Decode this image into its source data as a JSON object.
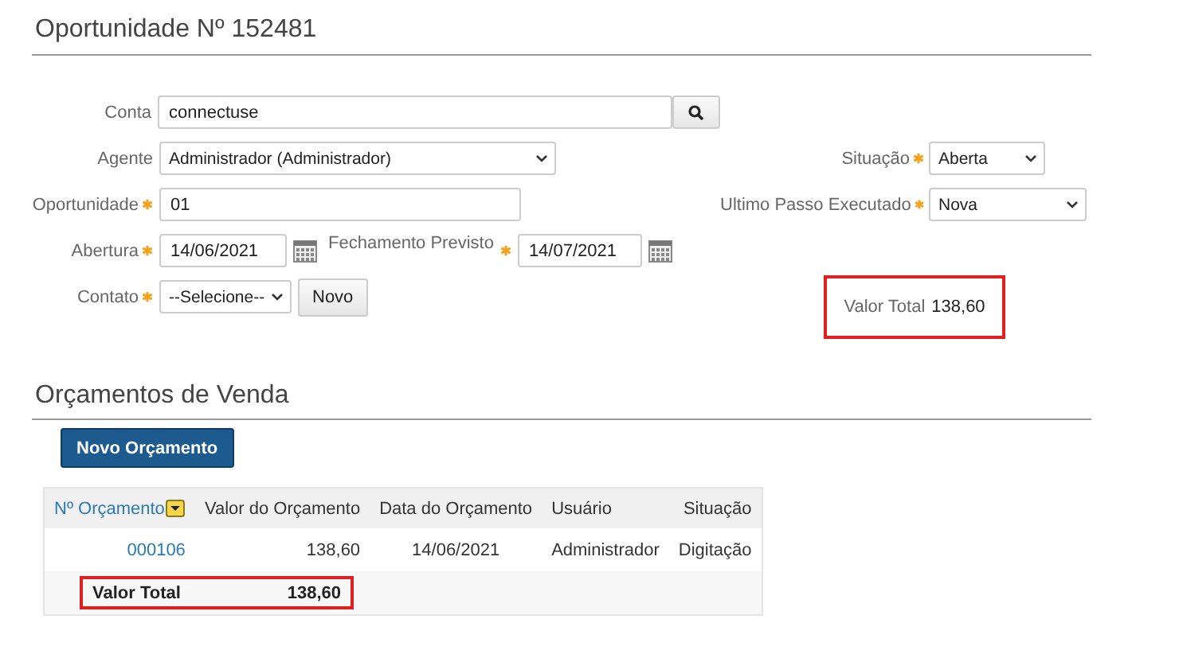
{
  "page_title": "Oportunidade Nº 152481",
  "left_fields": [
    {
      "kind": "search",
      "label": "Conta",
      "required": false,
      "value": "connectuse"
    },
    {
      "kind": "select",
      "label": "Agente",
      "required": false,
      "value": "Administrador (Administrador)"
    },
    {
      "kind": "text",
      "label": "Oportunidade",
      "required": true,
      "value": "01"
    },
    {
      "kind": "dates",
      "label": "Abertura",
      "required": true,
      "value": "14/06/2021",
      "second_label": "Fechamento Previsto",
      "second_required": true,
      "second_value": "14/07/2021"
    },
    {
      "kind": "select_button",
      "label": "Contato",
      "required": true,
      "value": "--Selecione--",
      "button": "Novo"
    }
  ],
  "right_fields": [
    {
      "label": "Situação",
      "required": true,
      "value": "Aberta"
    },
    {
      "label": "Ultimo Passo Executado",
      "required": true,
      "value": "Nova"
    }
  ],
  "total": {
    "label": "Valor Total",
    "value": "138,60",
    "highlighted": true
  },
  "section": {
    "title": "Orçamentos de Venda",
    "button": "Novo Orçamento",
    "table": {
      "columns": [
        {
          "label": "Nº Orçamento",
          "sort_menu": true
        },
        {
          "label": "Valor do Orçamento",
          "sort_menu": false
        },
        {
          "label": "Data do Orçamento",
          "sort_menu": false
        },
        {
          "label": "Usuário",
          "sort_menu": false
        },
        {
          "label": "Situação",
          "sort_menu": false
        }
      ],
      "rows": [
        [
          "000106",
          "138,60",
          "14/06/2021",
          "Administrador",
          "Digitação"
        ]
      ],
      "total": {
        "label": "Valor Total",
        "value": "138,60",
        "highlighted": true
      }
    }
  }
}
